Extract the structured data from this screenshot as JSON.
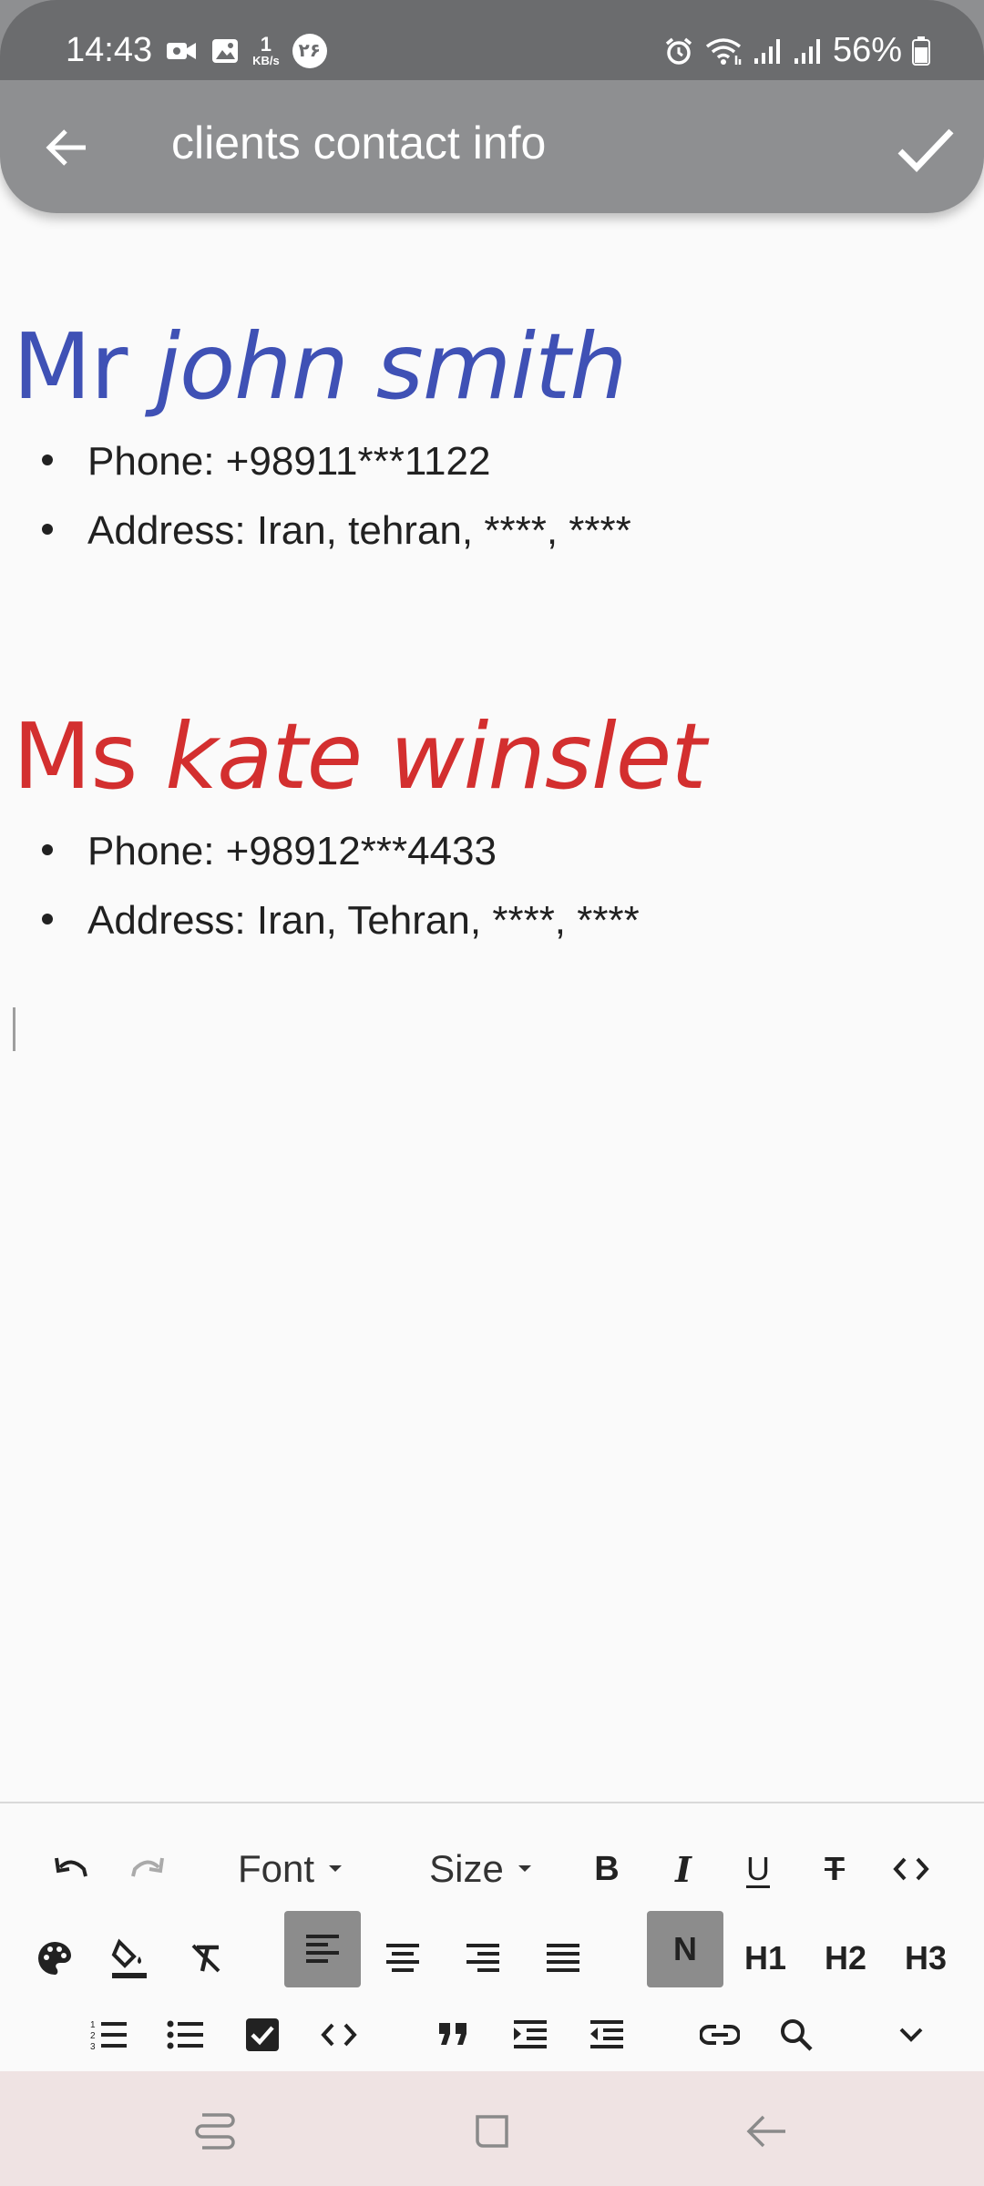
{
  "status_bar": {
    "time": "14:43",
    "network_speed_value": "1",
    "network_speed_unit": "KB/s",
    "notification_badge": "۲۶",
    "battery": "56%"
  },
  "app_bar": {
    "title": "clients contact info"
  },
  "document": {
    "contacts": [
      {
        "prefix": "Mr",
        "name": "john smith",
        "color": "#3f51b5",
        "phone": "Phone: +98911***1122",
        "address": "Address: Iran, tehran, ****, ****"
      },
      {
        "prefix": "Ms",
        "name": "kate winslet",
        "color": "#d32f2f",
        "phone": "Phone: +98912***4433",
        "address": "Address: Iran, Tehran, ****, ****"
      }
    ]
  },
  "toolbar": {
    "font_label": "Font",
    "size_label": "Size",
    "normal_label": "N",
    "h1_label": "H1",
    "h2_label": "H2",
    "h3_label": "H3",
    "active_color": "#8c8c8c"
  }
}
